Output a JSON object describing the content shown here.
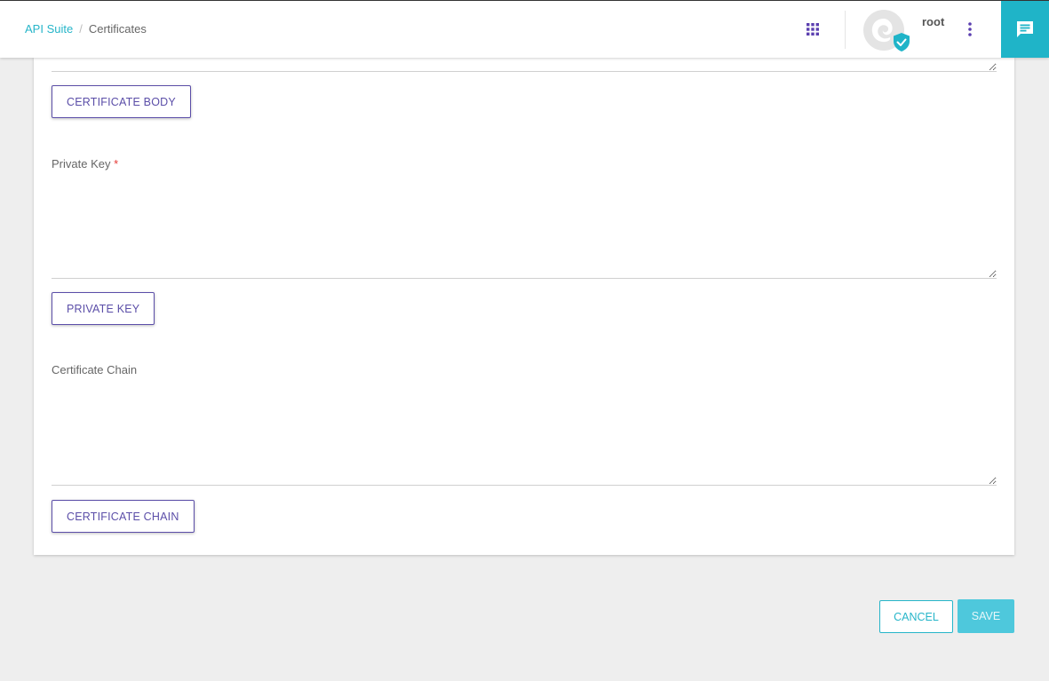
{
  "breadcrumb": {
    "parent": "API Suite",
    "separator": "/",
    "current": "Certificates"
  },
  "header": {
    "username": "root",
    "apps_icon": "apps-grid-icon",
    "more_icon": "more-vertical-icon",
    "chat_icon": "chat-icon",
    "accent_color": "#1fb4c8"
  },
  "form": {
    "certificate_body": {
      "value": "",
      "button_label": "CERTIFICATE BODY"
    },
    "private_key": {
      "label": "Private Key",
      "required_marker": "*",
      "value": "",
      "button_label": "PRIVATE KEY"
    },
    "certificate_chain": {
      "label": "Certificate Chain",
      "value": "",
      "button_label": "CERTIFICATE CHAIN"
    }
  },
  "actions": {
    "cancel_label": "CANCEL",
    "save_label": "SAVE"
  },
  "colors": {
    "primary_purple": "#5b4ea8",
    "accent_teal": "#26b5c9",
    "save_disabled": "#4ec8dc",
    "background": "#eeeeee"
  }
}
